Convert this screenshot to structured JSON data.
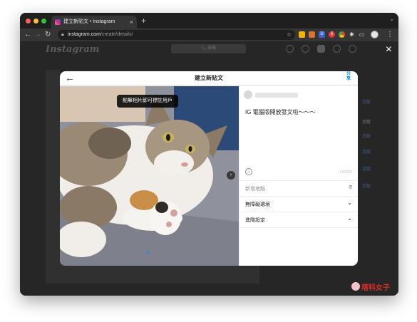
{
  "browser": {
    "tab_title": "建立新貼文 • Instagram",
    "tab_close": "×",
    "new_tab": "+",
    "tab_menu": "⌄",
    "url_host": "instagram.com",
    "url_path": "/create/details/",
    "back": "←",
    "forward": "→",
    "reload": "↻",
    "bookmark": "☆",
    "extensions": [
      {
        "name": "extension-yellow",
        "color": "#f4b400",
        "glyph": ""
      },
      {
        "name": "extension-fox",
        "color": "#d9742c",
        "glyph": ""
      },
      {
        "name": "extension-blue",
        "color": "#3b5fd9",
        "glyph": "D"
      },
      {
        "name": "extension-red",
        "color": "#e53935",
        "glyph": "S"
      },
      {
        "name": "extension-chrome",
        "color": "#4285f4",
        "glyph": ""
      },
      {
        "name": "puzzle-extensions",
        "color": "#353535",
        "glyph": "✱"
      },
      {
        "name": "cast",
        "color": "#353535",
        "glyph": "▭"
      }
    ],
    "menu": "⋮"
  },
  "instagram": {
    "logo": "Instagram",
    "search_placeholder": "搜尋"
  },
  "modal": {
    "close": "×",
    "back": "←",
    "title": "建立新貼文",
    "share": "分享",
    "photo_hint": "點擊相片即可標註用戶",
    "next": "›",
    "caption": "IG 電腦版開放發文啦～～～",
    "char_count": "14/2200",
    "emoji": "☺",
    "location_placeholder": "新增地點",
    "accessibility": "無障礙環境",
    "advanced": "進階設定",
    "location_icon": "⌾",
    "chevron": "⌄"
  },
  "background_links": [
    "追蹤",
    "追蹤",
    "追蹤",
    "追蹤",
    "追蹤",
    "追蹤"
  ],
  "watermark": "塔科女子",
  "colors": {
    "accent": "#0095f6",
    "page_bg": "#262626",
    "watermark": "#d93025"
  }
}
